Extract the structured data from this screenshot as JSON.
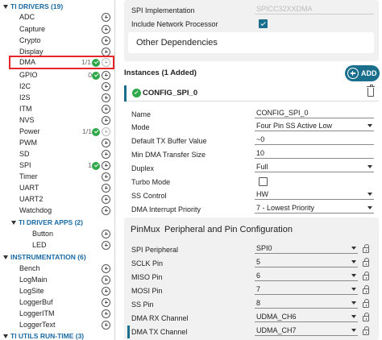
{
  "left_panel": {
    "sections": [
      {
        "title": "TI DRIVERS (19)"
      },
      {
        "title": "TI DRIVER APPS (2)"
      },
      {
        "title": "INSTRUMENTATION (6)"
      },
      {
        "title": "TI UTILS RUN-TIME (3)"
      }
    ],
    "drivers": [
      {
        "label": "ADC",
        "count": "",
        "ok": false
      },
      {
        "label": "Capture",
        "count": "",
        "ok": false
      },
      {
        "label": "Crypto",
        "count": "",
        "ok": false
      },
      {
        "label": "Display",
        "count": "",
        "ok": false
      },
      {
        "label": "DMA",
        "count": "1/1",
        "ok": true
      },
      {
        "label": "GPIO",
        "count": "0",
        "ok": true
      },
      {
        "label": "I2C",
        "count": "",
        "ok": false
      },
      {
        "label": "I2S",
        "count": "",
        "ok": false
      },
      {
        "label": "ITM",
        "count": "",
        "ok": false
      },
      {
        "label": "NVS",
        "count": "",
        "ok": false
      },
      {
        "label": "Power",
        "count": "1/1",
        "ok": true
      },
      {
        "label": "PWM",
        "count": "",
        "ok": false
      },
      {
        "label": "SD",
        "count": "",
        "ok": false
      },
      {
        "label": "SPI",
        "count": "1",
        "ok": true
      },
      {
        "label": "Timer",
        "count": "",
        "ok": false
      },
      {
        "label": "UART",
        "count": "",
        "ok": false
      },
      {
        "label": "UART2",
        "count": "",
        "ok": false
      },
      {
        "label": "Watchdog",
        "count": "",
        "ok": false
      }
    ],
    "driver_apps": [
      {
        "label": "Button"
      },
      {
        "label": "LED"
      }
    ],
    "instrumentation": [
      {
        "label": "Bench"
      },
      {
        "label": "LogMain"
      },
      {
        "label": "LogSite"
      },
      {
        "label": "LoggerBuf"
      },
      {
        "label": "LoggerITM"
      },
      {
        "label": "LoggerText"
      }
    ]
  },
  "right_panel": {
    "spi_implementation_label": "SPI Implementation",
    "spi_implementation_value": "SPICC32XXDMA",
    "include_np_label": "Include Network Processor",
    "other_dependencies_label": "Other Dependencies",
    "instances_label": "Instances (1 Added)",
    "add_button_label": "ADD",
    "instance_name": "CONFIG_SPI_0",
    "properties": [
      {
        "label": "Name",
        "value": "CONFIG_SPI_0",
        "kind": "text"
      },
      {
        "label": "Mode",
        "value": "Four Pin SS Active Low",
        "kind": "select"
      },
      {
        "label": "Default TX Buffer Value",
        "value": "~0",
        "kind": "text"
      },
      {
        "label": "Min DMA Transfer Size",
        "value": "10",
        "kind": "text"
      },
      {
        "label": "Duplex",
        "value": "Full",
        "kind": "select"
      },
      {
        "label": "Turbo Mode",
        "value": "",
        "kind": "checkbox"
      },
      {
        "label": "SS Control",
        "value": "HW",
        "kind": "select"
      },
      {
        "label": "DMA Interrupt Priority",
        "value": "7 - Lowest Priority",
        "kind": "select"
      }
    ],
    "pinmux_title_a": "PinMux",
    "pinmux_title_b": "Peripheral and Pin Configuration",
    "pinmux_rows": [
      {
        "label": "SPI Peripheral",
        "value": "SPI0"
      },
      {
        "label": "SCLK Pin",
        "value": "5"
      },
      {
        "label": "MISO Pin",
        "value": "6"
      },
      {
        "label": "MOSI Pin",
        "value": "7"
      },
      {
        "label": "SS Pin",
        "value": "8"
      },
      {
        "label": "DMA RX Channel",
        "value": "UDMA_CH6"
      },
      {
        "label": "DMA TX Channel",
        "value": "UDMA_CH7"
      }
    ]
  },
  "colors": {
    "section_blue": "#1a6aa6",
    "ok_green": "#2ea84a",
    "teal_button": "#1a6f8c",
    "highlight_red": "#e5262b"
  }
}
